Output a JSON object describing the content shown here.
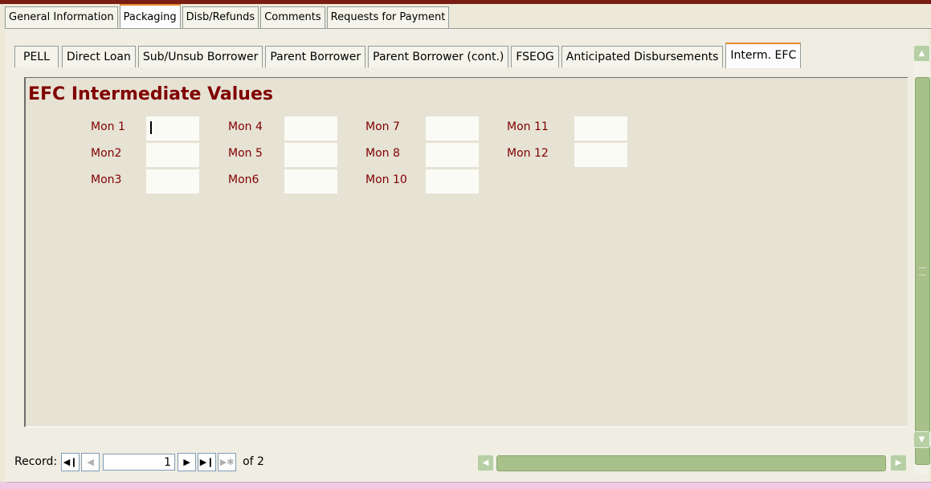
{
  "outer_tabs": [
    "General Information",
    "Packaging",
    "Disb/Refunds",
    "Comments",
    "Requests for Payment"
  ],
  "inner_tabs": [
    "PELL",
    "Direct Loan",
    "Sub/Unsub Borrower",
    "Parent Borrower",
    "Parent Borrower (cont.)",
    "FSEOG",
    "Anticipated Disbursements",
    "Interm. EFC"
  ],
  "form": {
    "title": "EFC Intermediate Values",
    "fields": [
      "Mon 1",
      "Mon2",
      "Mon3",
      "Mon 4",
      "Mon 5",
      "Mon6",
      "Mon 7",
      "Mon 8",
      "Mon 10",
      "Mon 11",
      "Mon 12"
    ]
  },
  "nav": {
    "label": "Record:",
    "current": "1",
    "total": "of 2"
  },
  "icons": {
    "first": "first-record-icon",
    "prev": "previous-record-icon",
    "next": "next-record-icon",
    "last": "last-record-icon",
    "new": "new-record-icon"
  }
}
